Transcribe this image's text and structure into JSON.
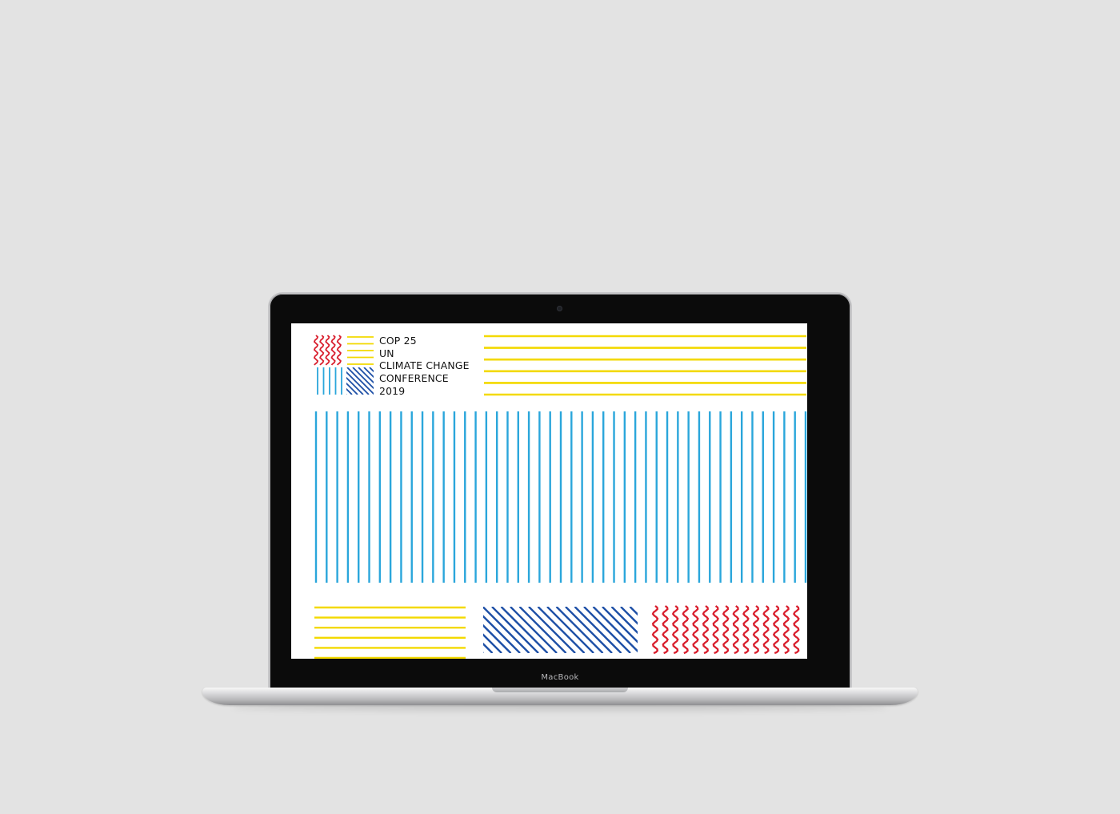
{
  "device": {
    "chin_label": "MacBook"
  },
  "screen": {
    "brand": {
      "line1": "COP 25",
      "line2": "UN",
      "line3": "CLIMATE CHANGE",
      "line4": "CONFERENCE",
      "line5": "2019"
    },
    "colors": {
      "yellow": "#f3d900",
      "blue": "#2aa6db",
      "navy": "#1d4fa6",
      "red": "#d91f2e"
    }
  }
}
